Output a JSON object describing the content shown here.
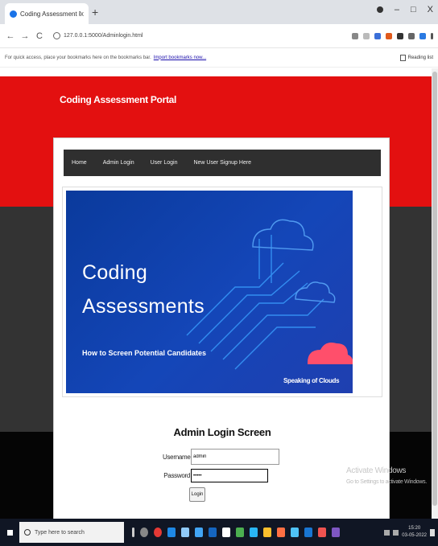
{
  "browser": {
    "tab_title": "Coding Assessment Portal",
    "tab_close": "x",
    "new_tab": "+",
    "url": "127.0.0.1:5000/Adminlogin.html",
    "bookmarks_text": "For quick access, place your bookmarks here on the bookmarks bar.",
    "bookmarks_link": "Import bookmarks now...",
    "reading_list": "Reading list",
    "nav_back": "←",
    "nav_forward": "→",
    "nav_reload": "C",
    "min": "–",
    "max": "□",
    "close": "X"
  },
  "page": {
    "portal_title": "Coding Assessment Portal",
    "nav": [
      "Home",
      "Admin Login",
      "User Login",
      "New User Signup Here"
    ],
    "banner": {
      "line1": "Coding",
      "line2": "Assessments",
      "subtitle": "How to Screen Potential Candidates",
      "brand": "Speaking of Clouds"
    },
    "login": {
      "title": "Admin Login Screen",
      "username_label": "Username",
      "username_value": "admin",
      "password_label": "Password",
      "password_value": "•••••",
      "button": "Login"
    }
  },
  "watermark": {
    "title": "Activate Windows",
    "subtitle": "Go to Settings to activate Windows."
  },
  "taskbar": {
    "search_placeholder": "Type here to search",
    "time": "15:20",
    "date": "03-05-2022"
  },
  "colors": {
    "header_red": "#e31010",
    "band_dark": "#333333",
    "nav_dark": "#2f2f2f",
    "banner_blue": "#1446b8",
    "taskbar": "#101624"
  }
}
